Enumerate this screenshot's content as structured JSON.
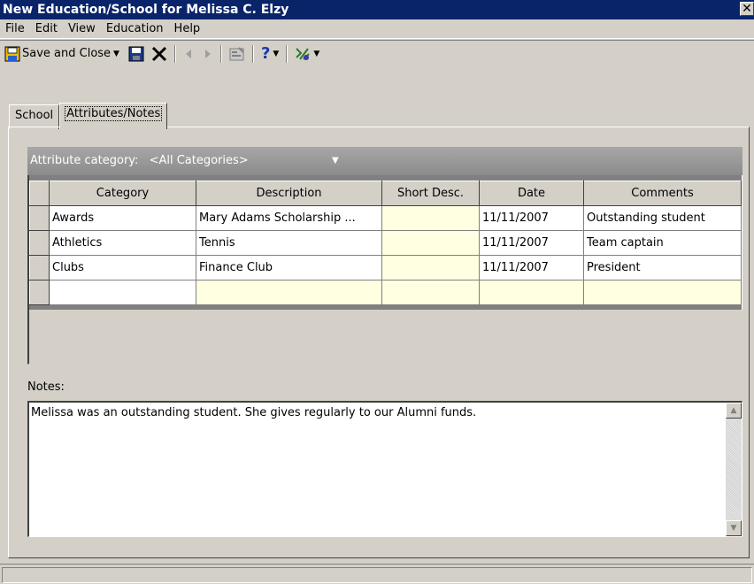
{
  "window": {
    "title": "New Education/School for Melissa C. Elzy",
    "close_glyph": "✕"
  },
  "menu": {
    "items": [
      "File",
      "Edit",
      "View",
      "Education",
      "Help"
    ]
  },
  "toolbar": {
    "save_close_label": "Save and Close",
    "icons": [
      "save-close-icon",
      "dropdown-arrow-icon",
      "save-icon",
      "delete-icon",
      "previous-icon",
      "next-icon",
      "properties-icon",
      "help-icon",
      "dropdown-arrow-icon",
      "tools-icon",
      "dropdown-arrow-icon"
    ]
  },
  "tabs": [
    {
      "label": "School",
      "active": false
    },
    {
      "label": "Attributes/Notes",
      "active": true
    }
  ],
  "attributes": {
    "category_label": "Attribute category:",
    "category_value": "<All Categories>",
    "columns": [
      "Category",
      "Description",
      "Short Desc.",
      "Date",
      "Comments"
    ],
    "rows": [
      {
        "category": "Awards",
        "description": "Mary Adams Scholarship ...",
        "short_desc": "",
        "date": "11/11/2007",
        "comments": "Outstanding student"
      },
      {
        "category": "Athletics",
        "description": "Tennis",
        "short_desc": "",
        "date": "11/11/2007",
        "comments": "Team captain"
      },
      {
        "category": "Clubs",
        "description": "Finance Club",
        "short_desc": "",
        "date": "11/11/2007",
        "comments": "President"
      }
    ]
  },
  "notes": {
    "label": "Notes:",
    "text": "Melissa was an outstanding student.  She gives regularly to our Alumni funds."
  },
  "colors": {
    "titlebar": "#0a246a",
    "chrome": "#d4d0c8",
    "required_cell": "#ffffe1"
  }
}
